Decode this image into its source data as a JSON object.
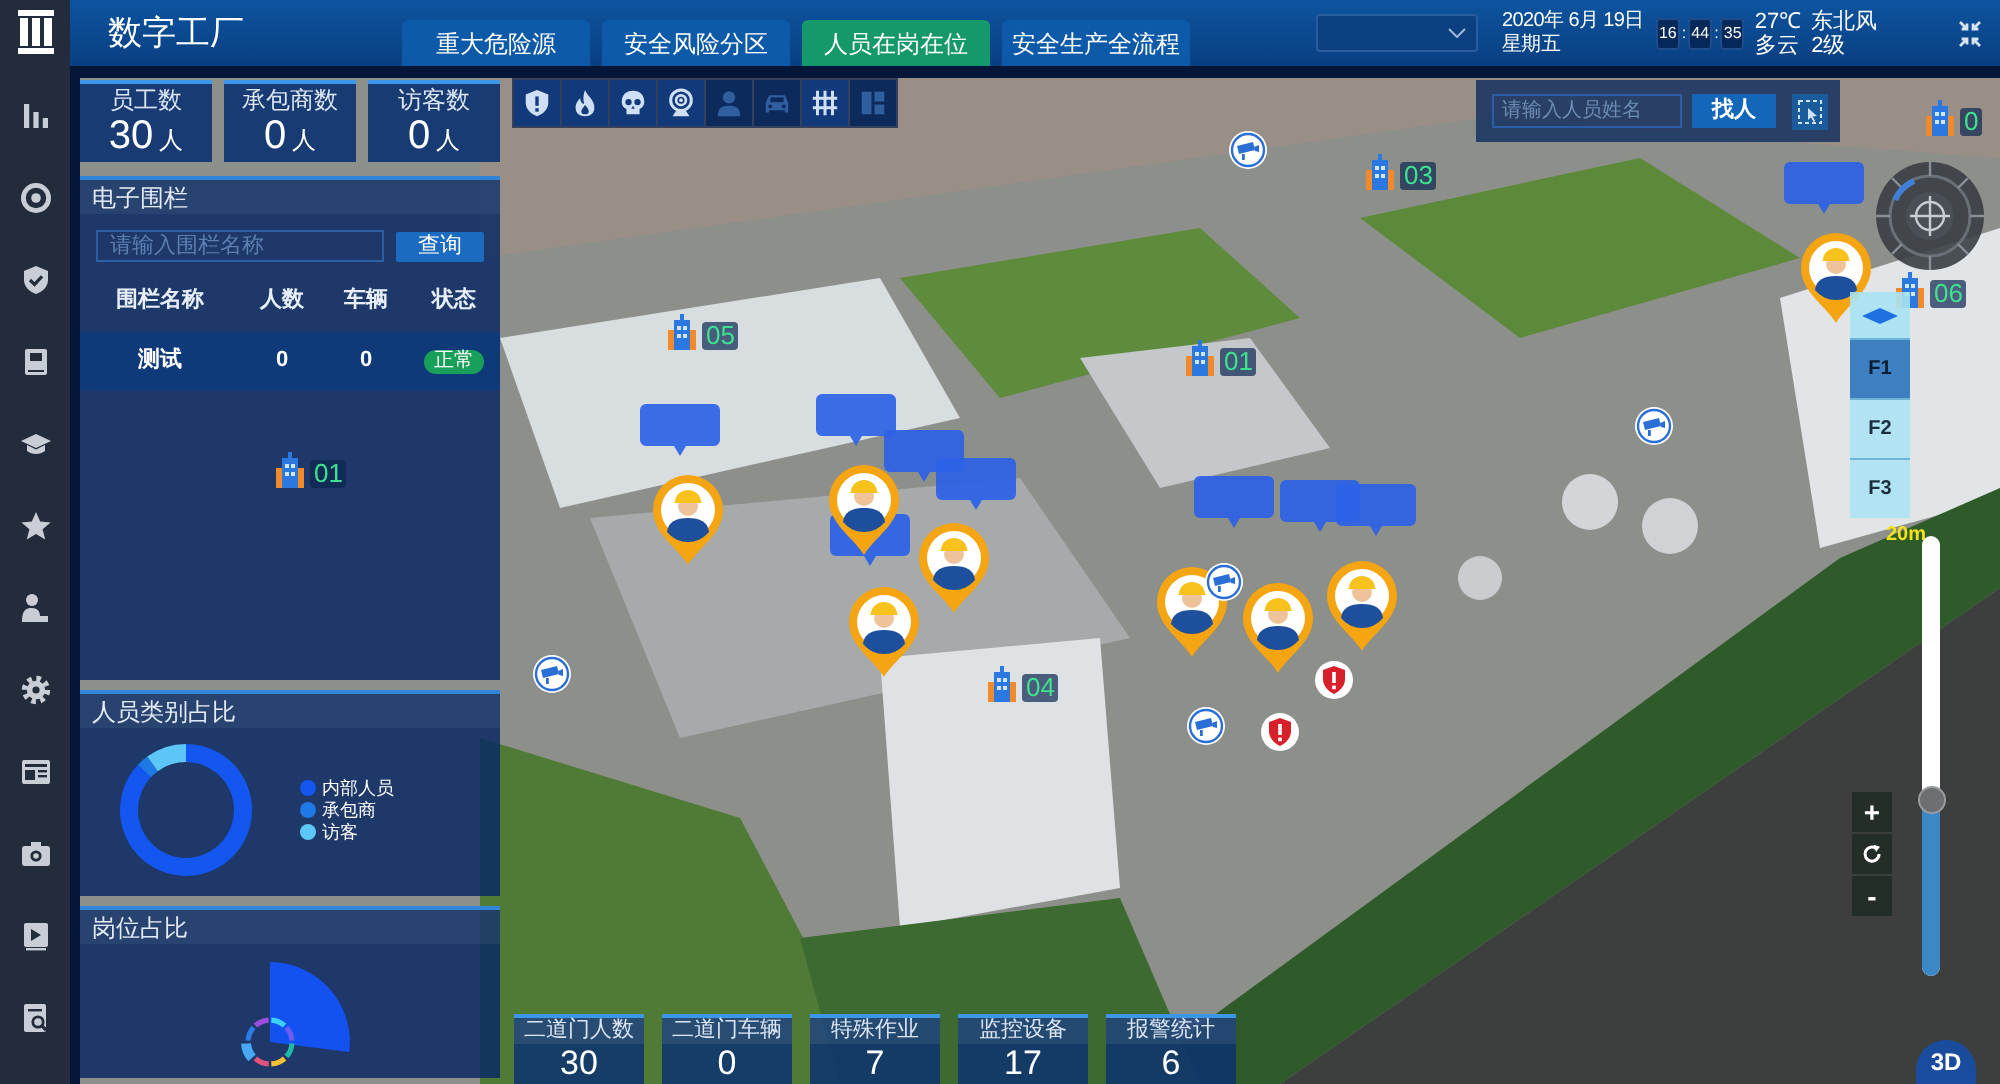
{
  "app": {
    "title": "数字工厂"
  },
  "tabs": [
    {
      "label": "重大危险源",
      "selected": false
    },
    {
      "label": "安全风险分区",
      "selected": false
    },
    {
      "label": "人员在岗在位",
      "selected": true
    },
    {
      "label": "安全生产全流程",
      "selected": false
    }
  ],
  "header": {
    "date": "2020年 6月 19日",
    "weekday": "星期五",
    "clock": {
      "hours": "16",
      "minutes": "44",
      "seconds": "35",
      "separators": [
        ":",
        ":"
      ]
    },
    "temperature": "27℃",
    "weather": "多云",
    "wind_direction": "东北风",
    "wind_level": "2级"
  },
  "summary_cards": [
    {
      "label": "员工数",
      "value": "30",
      "unit": "人"
    },
    {
      "label": "承包商数",
      "value": "0",
      "unit": "人"
    },
    {
      "label": "访客数",
      "value": "0",
      "unit": "人"
    }
  ],
  "fence_panel": {
    "title": "电子围栏",
    "search": {
      "placeholder": "请输入围栏名称"
    },
    "search_button": "查询",
    "columns": [
      "围栏名称",
      "人数",
      "车辆",
      "状态"
    ],
    "rows": [
      {
        "name": "测试",
        "people": "0",
        "vehicles": "0",
        "status": "正常"
      }
    ]
  },
  "category_panel": {
    "title": "人员类别占比",
    "legend": [
      {
        "label": "内部人员",
        "color": "#1456f0"
      },
      {
        "label": "承包商",
        "color": "#1e78e6"
      },
      {
        "label": "访客",
        "color": "#5cc6f7"
      }
    ]
  },
  "post_panel": {
    "title": "岗位占比"
  },
  "map_tools": [
    {
      "on": true
    },
    {
      "on": true
    },
    {
      "on": true
    },
    {
      "on": true
    },
    {
      "on": false
    },
    {
      "on": false
    },
    {
      "on": true
    },
    {
      "on": false
    }
  ],
  "person_search": {
    "placeholder": "请输入人员姓名",
    "button": "找人"
  },
  "map": {
    "building_labels": [
      {
        "label": "05"
      },
      {
        "label": "01"
      },
      {
        "label": "01"
      },
      {
        "label": "04"
      },
      {
        "label": "06"
      },
      {
        "label": "03"
      },
      {
        "label": "0"
      }
    ]
  },
  "floors": [
    {
      "label": "F1",
      "selected": true
    },
    {
      "label": "F2",
      "selected": false
    },
    {
      "label": "F3",
      "selected": false
    }
  ],
  "height_slider": {
    "label": "20m",
    "level": 0.4
  },
  "zoom_controls": {
    "zoom_in": "+",
    "zoom_out": "-"
  },
  "view_mode_button": "3D",
  "bottom_cards": [
    {
      "label": "二道门人数",
      "value": "30"
    },
    {
      "label": "二道门车辆",
      "value": "0"
    },
    {
      "label": "特殊作业",
      "value": "7"
    },
    {
      "label": "监控设备",
      "value": "17"
    },
    {
      "label": "报警统计",
      "value": "6"
    }
  ]
}
